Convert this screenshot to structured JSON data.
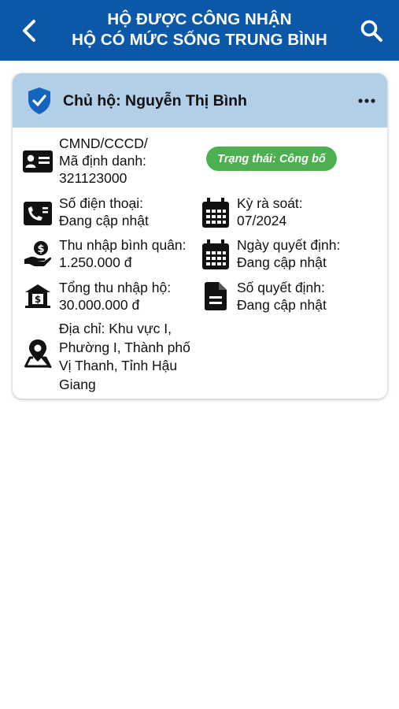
{
  "header": {
    "title_line1": "HỘ ĐƯỢC CÔNG NHẬN",
    "title_line2": "HỘ CÓ MỨC SỐNG TRUNG BÌNH",
    "back_icon": "chevron-left-icon",
    "search_icon": "search-icon"
  },
  "card": {
    "owner": "Chủ hộ: Nguyễn Thị Bình",
    "status_badge": "Trạng thái: Công bố",
    "status_color": "#4caf50",
    "head_color": "#b3cfe8",
    "id": {
      "line1": "CMND/CCCD/",
      "line2": "Mã định danh:",
      "value": "321123000"
    },
    "phone": {
      "label": "Số điện thoại:",
      "value": "Đang cập nhật"
    },
    "review_period": {
      "label": "Kỳ rà soát:",
      "value": "07/2024"
    },
    "avg_income": {
      "label": "Thu nhập bình quân:",
      "value": "1.250.000 đ"
    },
    "decision_date": {
      "label": "Ngày quyết định:",
      "value": "Đang cập nhật"
    },
    "total_income": {
      "label": "Tổng thu nhập hộ:",
      "value": "30.000.000 đ"
    },
    "decision_number": {
      "label": "Số quyết định:",
      "value": "Đang cập nhật"
    },
    "address": {
      "line1": "Địa chỉ: Khu vực I,",
      "line2": "Phường I, Thành phố",
      "line3": "Vị Thanh, Tỉnh Hậu",
      "line4": "Giang"
    }
  },
  "colors": {
    "header": "#0b58a8",
    "icon_dark": "#111111"
  }
}
